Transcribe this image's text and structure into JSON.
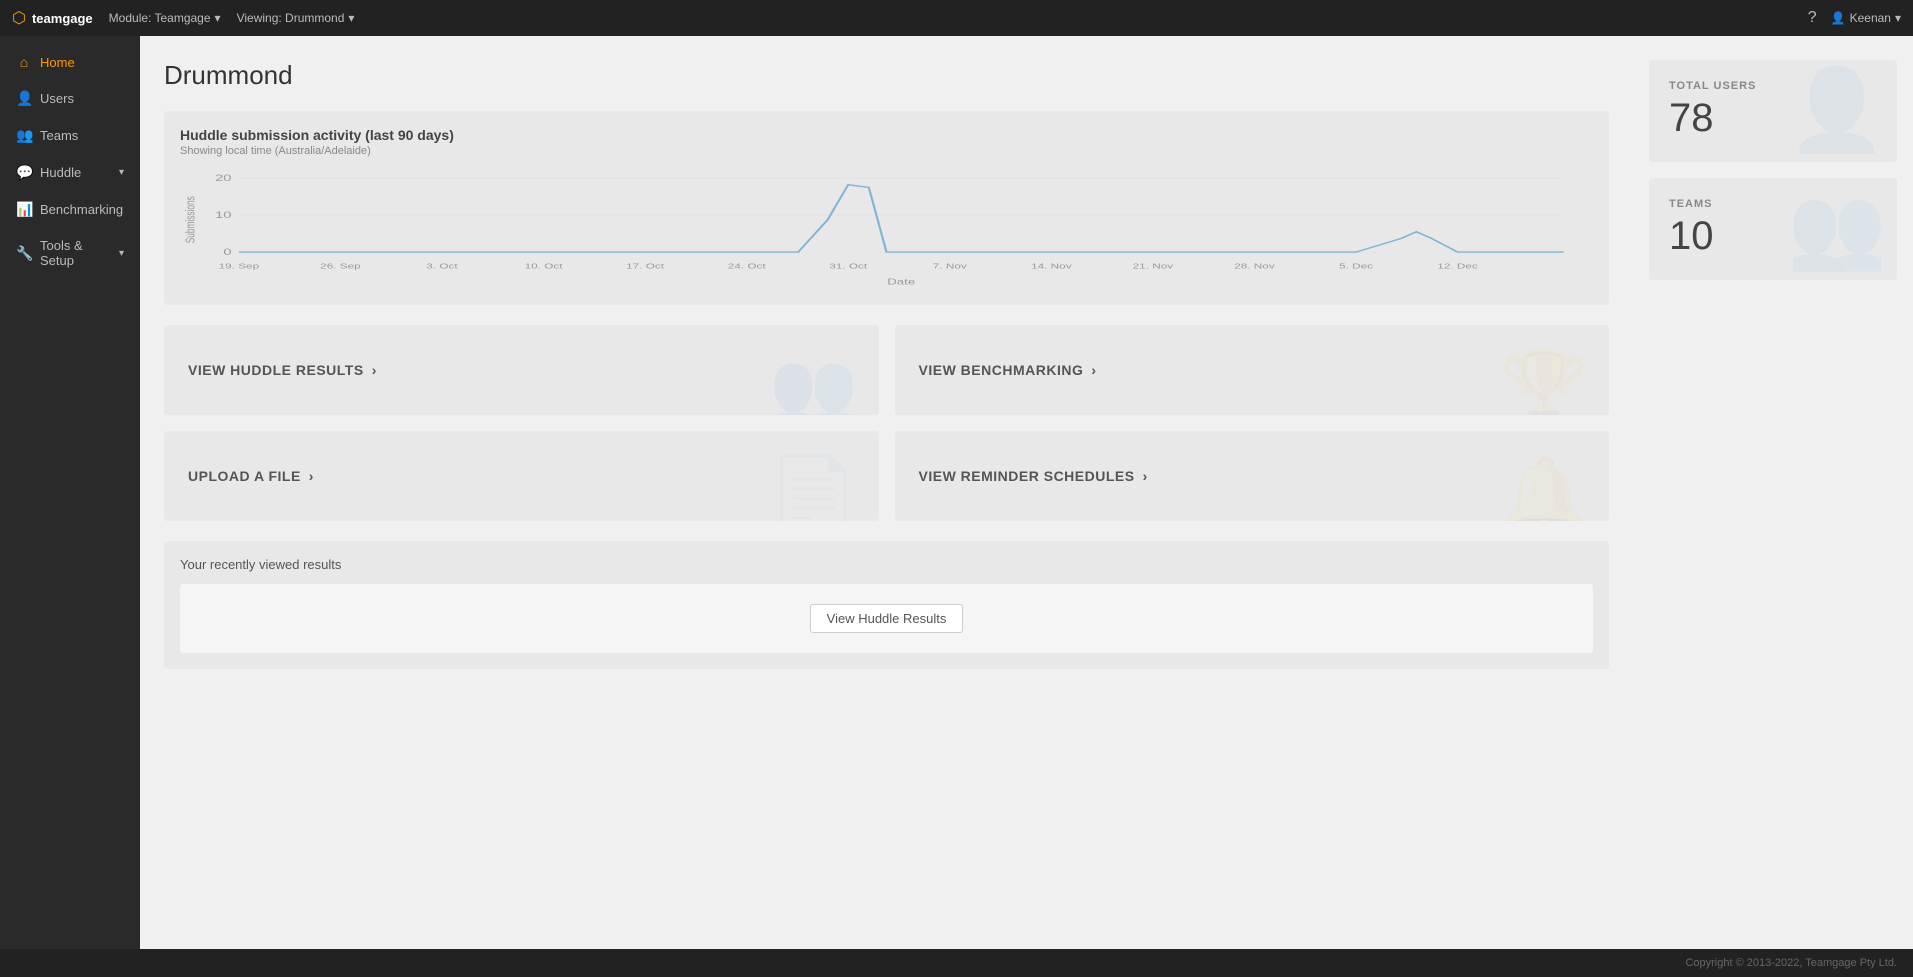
{
  "topnav": {
    "brand": "teamgage",
    "module_label": "Module: Teamgage",
    "viewing_label": "Viewing: Drummond",
    "help_icon": "?",
    "user_label": "Keenan"
  },
  "sidebar": {
    "items": [
      {
        "id": "home",
        "label": "Home",
        "icon": "⌂",
        "active": true
      },
      {
        "id": "users",
        "label": "Users",
        "icon": "👤",
        "active": false
      },
      {
        "id": "teams",
        "label": "Teams",
        "icon": "👥",
        "active": false
      },
      {
        "id": "huddle",
        "label": "Huddle",
        "icon": "💬",
        "active": false,
        "has_arrow": true
      },
      {
        "id": "benchmarking",
        "label": "Benchmarking",
        "icon": "📊",
        "active": false
      },
      {
        "id": "tools",
        "label": "Tools & Setup",
        "icon": "🔧",
        "active": false,
        "has_arrow": true
      }
    ]
  },
  "page": {
    "title": "Drummond"
  },
  "chart": {
    "title": "Huddle submission activity (last 90 days)",
    "subtitle": "Showing local time (Australia/Adelaide)",
    "x_axis_title": "Date",
    "y_axis_title": "Submissions",
    "x_labels": [
      "19. Sep",
      "26. Sep",
      "3. Oct",
      "10. Oct",
      "17. Oct",
      "24. Oct",
      "31. Oct",
      "7. Nov",
      "14. Nov",
      "21. Nov",
      "28. Nov",
      "5. Dec",
      "12. Dec"
    ],
    "y_labels": [
      "0",
      "10",
      "20"
    ],
    "peak_label": "Oct"
  },
  "action_cards": [
    {
      "id": "view-huddle",
      "label": "VIEW HUDDLE RESULTS",
      "icon": "👥"
    },
    {
      "id": "view-benchmarking",
      "label": "VIEW BENCHMARKING",
      "icon": "🏆"
    },
    {
      "id": "upload-file",
      "label": "UPLOAD A FILE",
      "icon": "📄"
    },
    {
      "id": "view-reminders",
      "label": "VIEW REMINDER SCHEDULES",
      "icon": "🔔"
    }
  ],
  "recently_viewed": {
    "title": "Your recently viewed results",
    "button_label": "View Huddle Results"
  },
  "stats": [
    {
      "id": "total-users",
      "label": "TOTAL USERS",
      "value": "78",
      "icon": "👤"
    },
    {
      "id": "teams",
      "label": "TEAMS",
      "value": "10",
      "icon": "👥"
    }
  ],
  "footer": {
    "copyright": "Copyright © 2013-2022, Teamgage Pty Ltd."
  }
}
